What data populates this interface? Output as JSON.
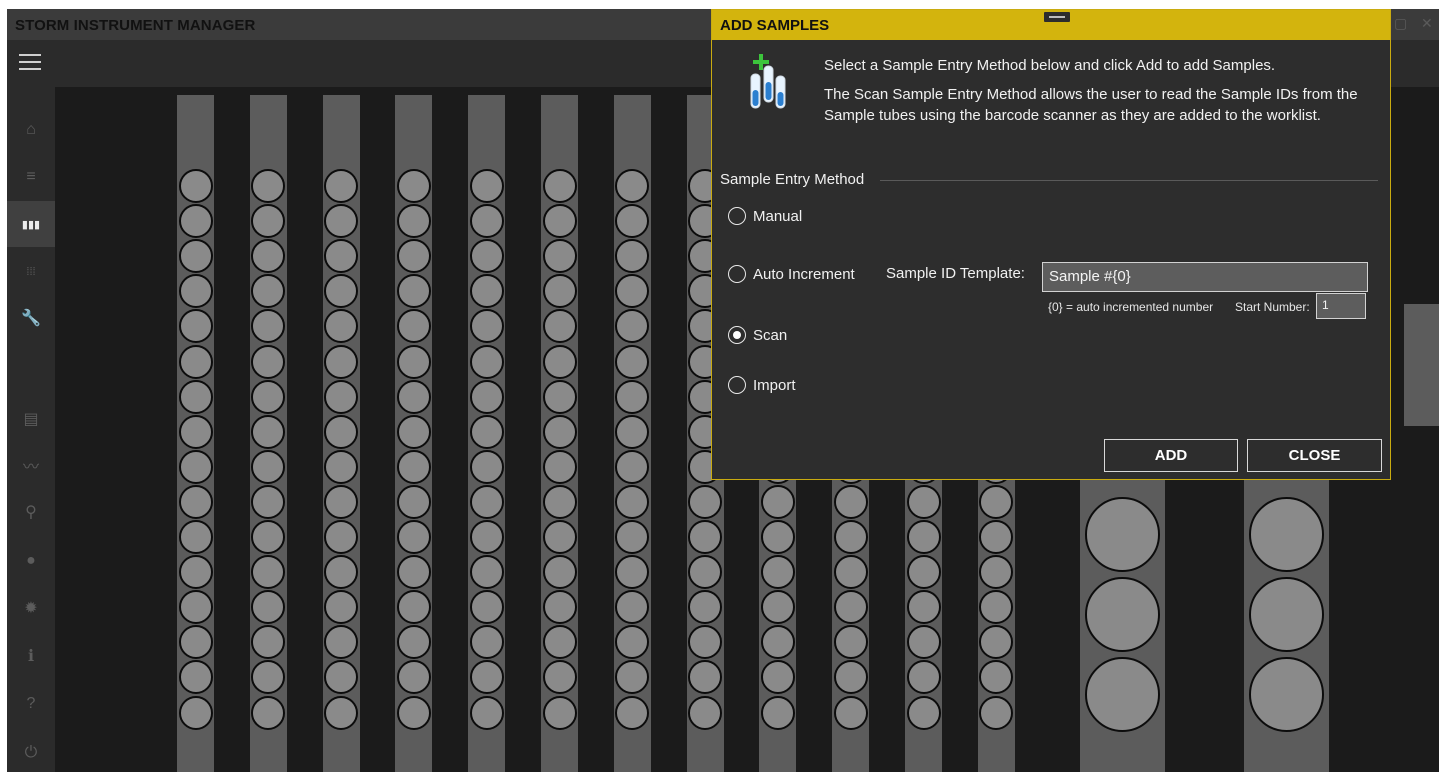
{
  "app": {
    "title": "STORM INSTRUMENT MANAGER",
    "window_controls": {
      "maximize": "▢",
      "close": "✕"
    }
  },
  "sidebar": {
    "items": [
      {
        "name": "home",
        "glyph": "⌂",
        "active": false
      },
      {
        "name": "worklist",
        "glyph": "≡",
        "active": false
      },
      {
        "name": "rack-layout",
        "glyph": "▮▮▮",
        "active": true
      },
      {
        "name": "plate",
        "glyph": "⁞⁞⁞",
        "active": false
      },
      {
        "name": "maintenance",
        "glyph": "🔧",
        "active": false
      },
      {
        "name": "reports",
        "glyph": "▤",
        "active": false
      },
      {
        "name": "chart",
        "glyph": "〰",
        "active": false
      },
      {
        "name": "search",
        "glyph": "⚲",
        "active": false
      },
      {
        "name": "user",
        "glyph": "●",
        "active": false
      },
      {
        "name": "settings",
        "glyph": "✹",
        "active": false
      },
      {
        "name": "info",
        "glyph": "ℹ",
        "active": false
      },
      {
        "name": "help",
        "glyph": "?",
        "active": false
      },
      {
        "name": "power",
        "glyph": "⏻",
        "active": false
      }
    ]
  },
  "deck": {
    "tube_racks": 12,
    "tube_positions_per_rack": 16,
    "large_racks": 2,
    "large_positions_per_rack": 3
  },
  "dialog": {
    "title": "ADD SAMPLES",
    "icon": "sample-tubes-add-icon",
    "intro": "Select a Sample Entry Method below and click Add to add Samples.",
    "description": "The Scan Sample Entry Method allows the user to read the Sample IDs from the Sample tubes using the barcode scanner as they are added to the worklist.",
    "section_label": "Sample Entry Method",
    "methods": [
      {
        "label": "Manual",
        "checked": false
      },
      {
        "label": "Auto Increment",
        "checked": false
      },
      {
        "label": "Scan",
        "checked": true
      },
      {
        "label": "Import",
        "checked": false
      }
    ],
    "sample_id_template_label": "Sample ID Template:",
    "sample_id_template_value": "Sample #{0}",
    "template_hint": "{0} = auto incremented number",
    "start_number_label": "Start Number:",
    "start_number_value": "1",
    "add_label": "ADD",
    "close_label": "CLOSE"
  },
  "colors": {
    "accent": "#d3b40d",
    "background": "#1b1b1b",
    "dialog": "#2d2d2d",
    "rack": "#5c5c5c",
    "well": "#8a8a8a"
  }
}
